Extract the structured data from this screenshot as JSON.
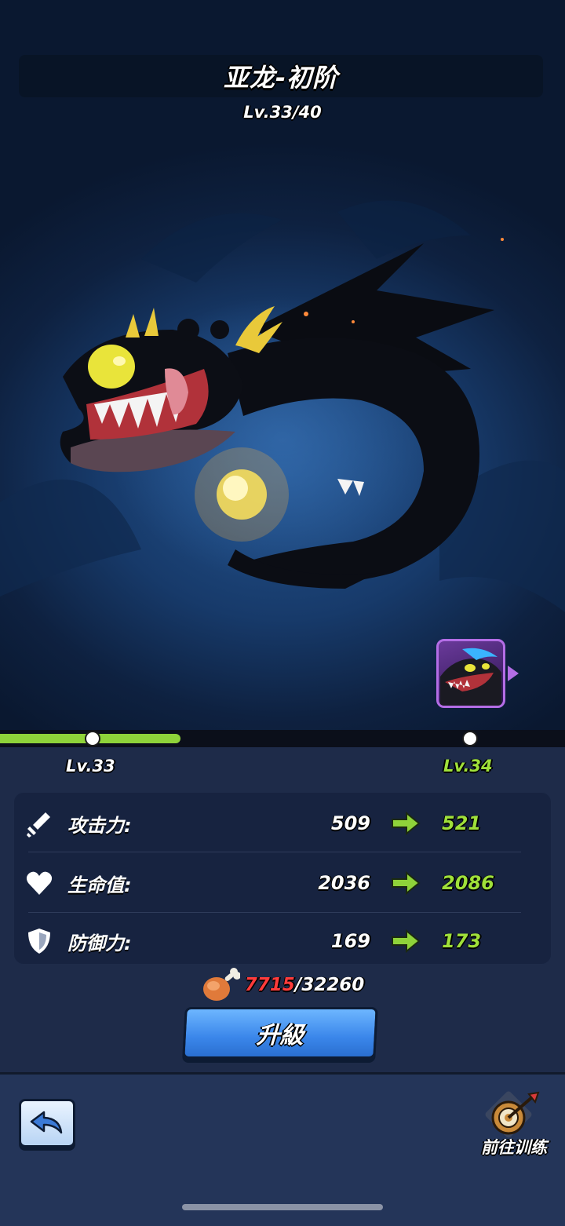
{
  "header": {
    "title": "亚龙-初阶",
    "level_text": "Lv.33/40"
  },
  "pet": {
    "image_icon": "dragon-illustration",
    "portrait_icon": "evolved-dragon-portrait-icon"
  },
  "progress": {
    "fraction": 0.32,
    "current_level_label": "Lv.33",
    "next_level_label": "Lv.34"
  },
  "stats": [
    {
      "icon": "sword-icon",
      "name": "攻击力:",
      "current": "509",
      "next": "521"
    },
    {
      "icon": "heart-icon",
      "name": "生命值:",
      "current": "2036",
      "next": "2086"
    },
    {
      "icon": "shield-icon",
      "name": "防御力:",
      "current": "169",
      "next": "173"
    }
  ],
  "cost": {
    "icon": "meat-icon",
    "have": "7715",
    "separator": "/",
    "need": "32260"
  },
  "buttons": {
    "upgrade_label": "升級",
    "back_icon": "back-arrow-icon",
    "train_icon": "target-icon",
    "train_label": "前往训练"
  },
  "colors": {
    "accent_green": "#9fe03a",
    "cost_red": "#ff3b3b",
    "button_blue": "#3a86ea",
    "portrait_purple": "#b46de6"
  }
}
